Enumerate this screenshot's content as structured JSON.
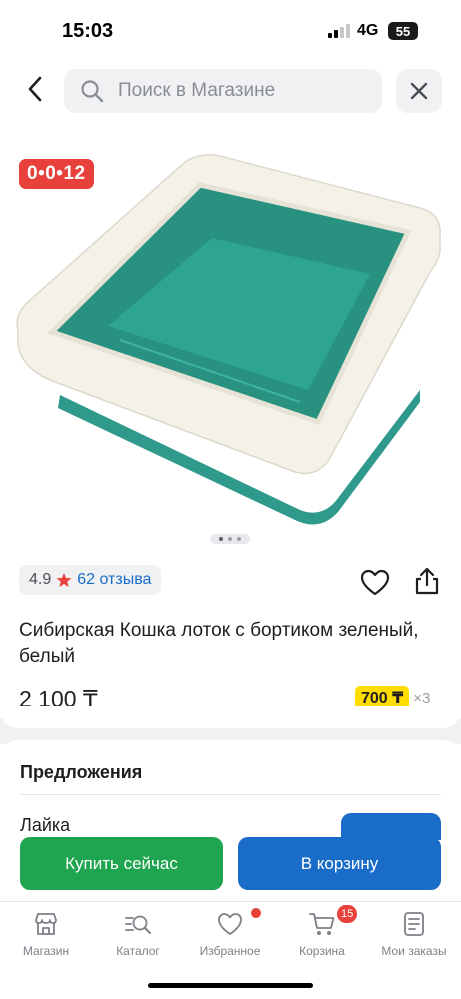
{
  "status_bar": {
    "time": "15:03",
    "network": "4G",
    "battery": "55"
  },
  "header": {
    "search_placeholder": "Поиск в Магазине"
  },
  "product": {
    "timer": "0•0•12",
    "rating": "4.9",
    "reviews": "62 отзыва",
    "title": "Сибирская Кошка лоток с бортиком зеленый, белый",
    "price": "2 100 ₸",
    "installment_price": "700 ₸",
    "installment_count": "×3",
    "gallery_dots": 3,
    "gallery_active": 0
  },
  "offers": {
    "heading": "Предложения",
    "seller": "Лайка"
  },
  "actions": {
    "buy_now": "Купить сейчас",
    "add_to_cart": "В корзину"
  },
  "nav": {
    "items": [
      {
        "label": "Магазин",
        "icon": "store-icon"
      },
      {
        "label": "Каталог",
        "icon": "catalog-search-icon"
      },
      {
        "label": "Избранное",
        "icon": "heart-icon"
      },
      {
        "label": "Корзина",
        "icon": "cart-icon",
        "badge": "15"
      },
      {
        "label": "Мои заказы",
        "icon": "orders-icon"
      }
    ]
  },
  "colors": {
    "accent_red": "#e8403a",
    "primary_blue": "#1a6cc9",
    "buy_green": "#1fa54f",
    "installment_yellow": "#ffdd00"
  }
}
